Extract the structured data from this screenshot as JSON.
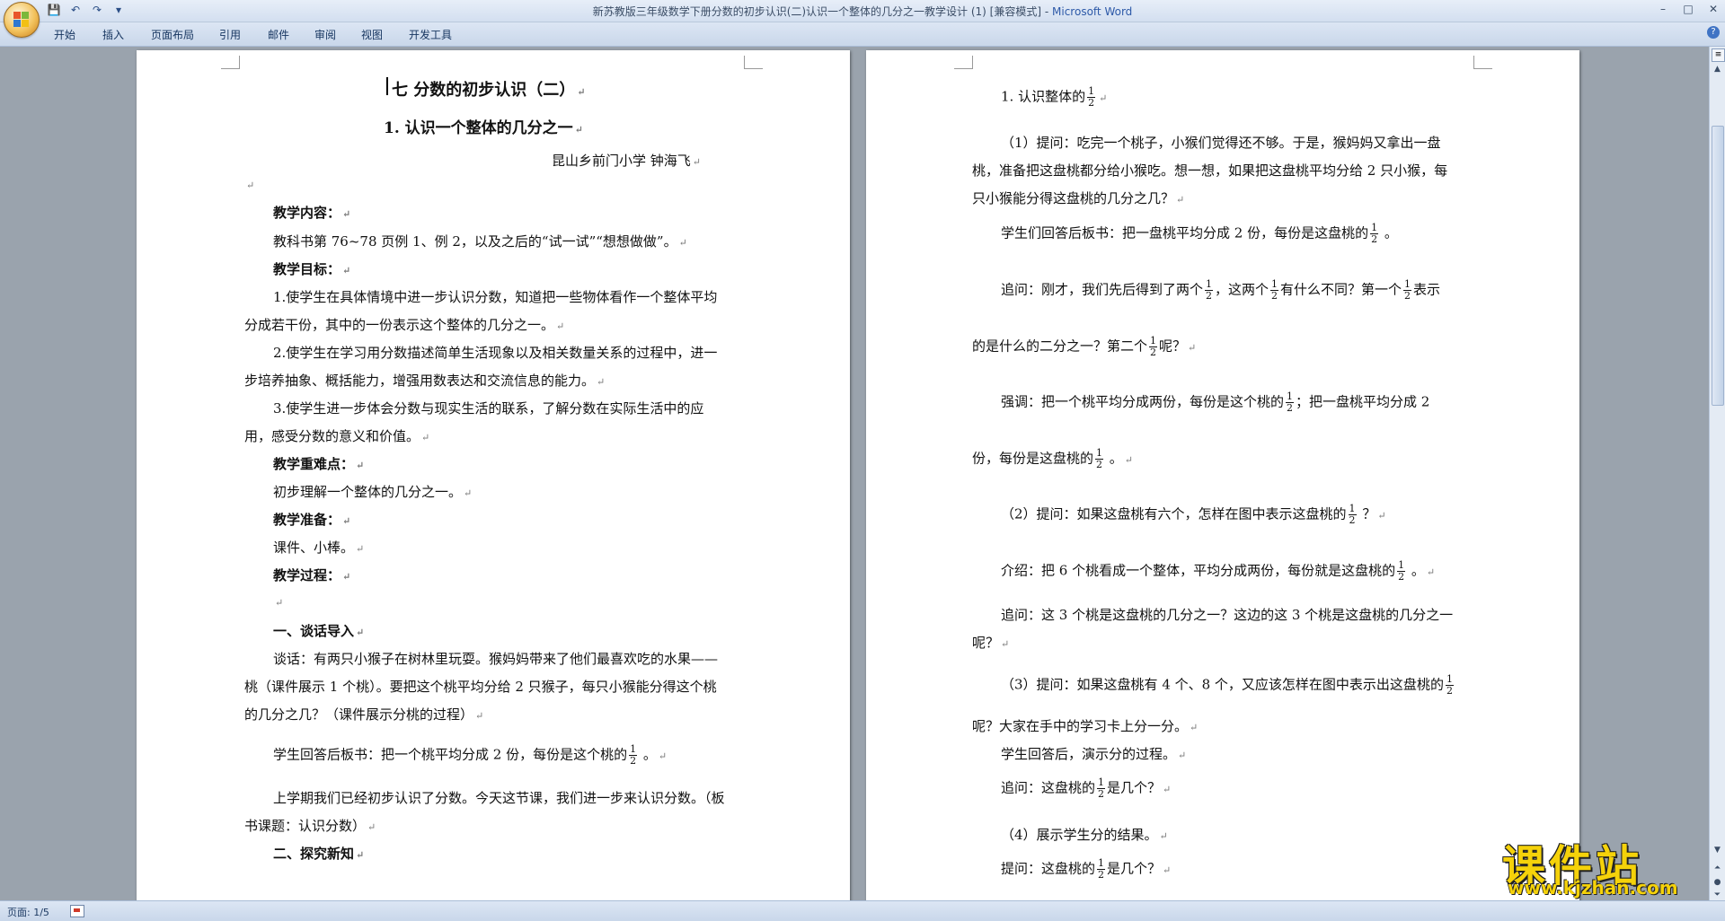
{
  "window": {
    "title_doc": "新苏教版三年级数学下册分数的初步认识(二)认识一个整体的几分之一教学设计 (1) [兼容模式]",
    "title_sep": " - ",
    "title_app": "Microsoft Word",
    "minimize": "–",
    "maximize": "□",
    "close": "✕",
    "help": "?"
  },
  "ribbon_tabs": [
    "开始",
    "插入",
    "页面布局",
    "引用",
    "邮件",
    "审阅",
    "视图",
    "开发工具"
  ],
  "page1": {
    "heading1": "七  分数的初步认识（二）",
    "heading2": "1. 认识一个整体的几分之一",
    "author": "昆山乡前门小学   钟海飞",
    "content_label": "教学内容：",
    "content_text": "教科书第 76~78 页例 1、例 2，以及之后的“试一试”“想想做做”。",
    "goal_label": "教学目标：",
    "goal1_a": "1.使学生在具体情境中进一步认识分数，知道把一些物体看作一个整体平均",
    "goal1_b": "分成若干份，其中的一份表示这个整体的几分之一。",
    "goal2_a": "2.使学生在学习用分数描述简单生活现象以及相关数量关系的过程中，进一",
    "goal2_b": "步培养抽象、概括能力，增强用数表达和交流信息的能力。",
    "goal3_a": "3.使学生进一步体会分数与现实生活的联系，了解分数在实际生活中的应",
    "goal3_b": "用，感受分数的意义和价值。",
    "key_label": "教学重难点：",
    "key_text": "初步理解一个整体的几分之一。",
    "prep_label": "教学准备：",
    "prep_text": "课件、小棒。",
    "process_label": "教学过程：",
    "sec1": "一、谈话导入",
    "talk_a": "谈话：有两只小猴子在树林里玩耍。猴妈妈带来了他们最喜欢吃的水果——",
    "talk_b": "桃（课件展示 1 个桃）。要把这个桃平均分给 2 只猴子，每只小猴能分得这个桃",
    "talk_c": "的几分之几？（课件展示分桃的过程）",
    "answer": "学生回答后板书：把一个桃平均分成 2 份，每份是这个桃的",
    "answer_end": " 。",
    "review_a": "上学期我们已经初步认识了分数。今天这节课，我们进一步来认识分数。（板",
    "review_b": "书课题：认识分数）",
    "sec2": "二、探究新知"
  },
  "page2": {
    "l1": "1. 认识整体的",
    "q1_a": "（1）提问：吃完一个桃子，小猴们觉得还不够。于是，猴妈妈又拿出一盘",
    "q1_b": "桃，准备把这盘桃都分给小猴吃。想一想，如果把这盘桃平均分给 2 只小猴，每",
    "q1_c": "只小猴能分得这盘桃的几分之几？",
    "ans1": "学生们回答后板书：把一盘桃平均分成 2 份，每份是这盘桃的",
    "ans1_end": " 。",
    "ask1_a": "追问：刚才，我们先后得到了两个",
    "ask1_b": "，这两个",
    "ask1_c": "有什么不同？第一个",
    "ask1_d": "表示",
    "ask1_e": "的是什么的二分之一？第二个",
    "ask1_f": "呢？",
    "emph_a": "强调：把一个桃平均分成两份，每份是这个桃的",
    "emph_b": "；把一盘桃平均分成 2",
    "emph_c": "份，每份是这盘桃的",
    "emph_d": " 。",
    "q2": "（2）提问：如果这盘桃有六个，怎样在图中表示这盘桃的",
    "q2_end": " ？",
    "intro": "介绍：把 6 个桃看成一个整体，平均分成两份，每份就是这盘桃的",
    "intro_end": " 。",
    "ask2_a": "追问：这 3 个桃是这盘桃的几分之一？这边的这 3 个桃是这盘桃的几分之一",
    "ask2_b": "呢？",
    "q3_a": "（3）提问：如果这盘桃有 4 个、8 个，又应该怎样在图中表示出这盘桃的",
    "q3_b": "呢？大家在手中的学习卡上分一分。",
    "demo": "学生回答后，演示分的过程。",
    "ask3": "追问：这盘桃的",
    "ask3_end": "是几个？",
    "show": "（4）展示学生分的结果。",
    "ask4": "提问：这盘桃的",
    "ask4_end": "是几个？"
  },
  "fraction": {
    "num": "1",
    "den": "2"
  },
  "para_mark": "↵",
  "status": {
    "page": "页面: 1/5"
  },
  "watermark": {
    "name": "课件站",
    "url": "www.kjzhan.com"
  }
}
